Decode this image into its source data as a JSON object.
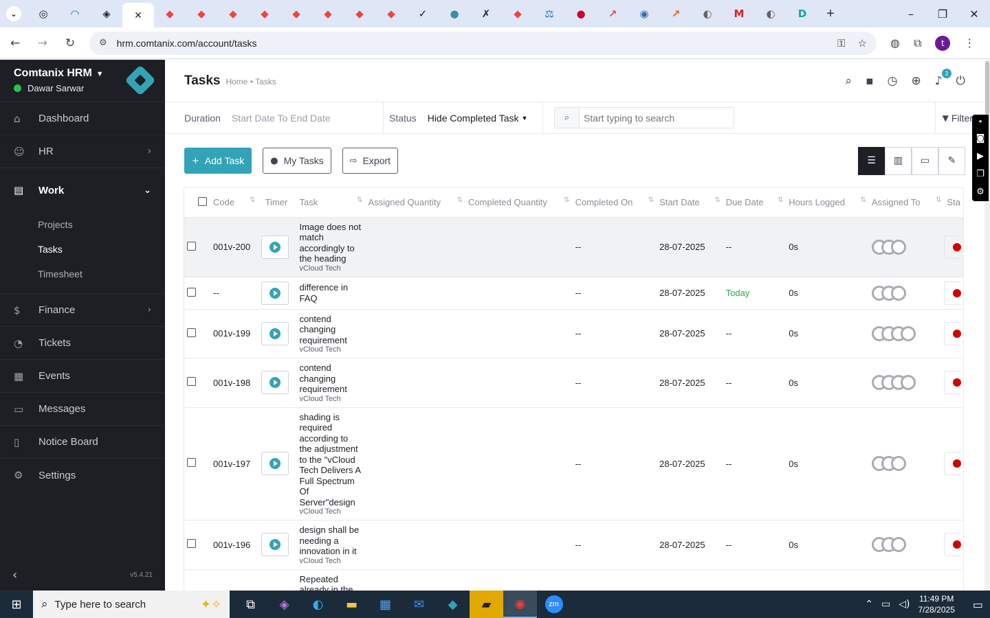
{
  "browser": {
    "tabs": [
      "◎",
      "◠",
      "◈",
      "✕",
      "◆",
      "◆",
      "◆",
      "◆",
      "◆",
      "◆",
      "◆",
      "◆",
      "✓",
      "●",
      "✗",
      "◆",
      "⚖",
      "●",
      "↗",
      "◉",
      "↗",
      "◐",
      "M",
      "◐",
      "D"
    ],
    "new_tab": "+",
    "url": "hrm.comtanix.com/account/tasks"
  },
  "sidebar": {
    "company": "Comtanix HRM",
    "user": "Dawar Sarwar",
    "items": [
      {
        "label": "Dashboard",
        "icon": "⌂"
      },
      {
        "label": "HR",
        "icon": "☺"
      },
      {
        "label": "Work",
        "icon": "▤"
      },
      {
        "label": "Finance",
        "icon": "$"
      },
      {
        "label": "Tickets",
        "icon": "◔"
      },
      {
        "label": "Events",
        "icon": "▦"
      },
      {
        "label": "Messages",
        "icon": "▭"
      },
      {
        "label": "Notice Board",
        "icon": "▯"
      },
      {
        "label": "Settings",
        "icon": "⚙"
      }
    ],
    "work_sub": [
      "Projects",
      "Tasks",
      "Timesheet"
    ],
    "version": "v5.4.21"
  },
  "header": {
    "title": "Tasks",
    "breadcrumb": "Home • Tasks",
    "notif_count": "2"
  },
  "filters": {
    "duration_label": "Duration",
    "duration_value": "Start Date To End Date",
    "status_label": "Status",
    "status_value": "Hide Completed Task",
    "search_placeholder": "Start typing to search",
    "filters_label": "Filters"
  },
  "actions": {
    "add_task": "Add Task",
    "my_tasks": "My Tasks",
    "export": "Export"
  },
  "table": {
    "columns": [
      "Code",
      "Timer",
      "Task",
      "Assigned Quantity",
      "Completed Quantity",
      "Completed On",
      "Start Date",
      "Due Date",
      "Hours Logged",
      "Assigned To",
      "Sta"
    ],
    "rows": [
      {
        "code": "001v-200",
        "task": "Image does not match accordingly to the heading",
        "project": "vCloud Tech",
        "completed_on": "--",
        "start": "28-07-2025",
        "due": "--",
        "hours": "0s",
        "avatars": 3,
        "today": false
      },
      {
        "code": "--",
        "task": "difference in FAQ",
        "project": "",
        "completed_on": "--",
        "start": "28-07-2025",
        "due": "Today",
        "hours": "0s",
        "avatars": 3,
        "today": true
      },
      {
        "code": "001v-199",
        "task": "contend changing requirement",
        "project": "vCloud Tech",
        "completed_on": "--",
        "start": "28-07-2025",
        "due": "--",
        "hours": "0s",
        "avatars": 4,
        "today": false
      },
      {
        "code": "001v-198",
        "task": "contend changing requirement",
        "project": "vCloud Tech",
        "completed_on": "--",
        "start": "28-07-2025",
        "due": "--",
        "hours": "0s",
        "avatars": 4,
        "today": false
      },
      {
        "code": "001v-197",
        "task": "shading is required according to the adjustment to the \"vCloud Tech Delivers A Full Spectrum Of Server\"design",
        "project": "vCloud Tech",
        "completed_on": "--",
        "start": "28-07-2025",
        "due": "--",
        "hours": "0s",
        "avatars": 3,
        "today": false
      },
      {
        "code": "001v-196",
        "task": "design shall be needing a innovation in it",
        "project": "vCloud Tech",
        "completed_on": "--",
        "start": "28-07-2025",
        "due": "--",
        "hours": "0s",
        "avatars": 3,
        "today": false
      },
      {
        "code": "",
        "task": "Repeated already in the",
        "project": "",
        "completed_on": "",
        "start": "",
        "due": "",
        "hours": "",
        "avatars": 0,
        "today": false
      }
    ]
  },
  "taskbar": {
    "search_placeholder": "Type here to search",
    "time": "11:49 PM",
    "date": "7/28/2025"
  },
  "colors": {
    "accent": "#33a3b7",
    "sidebar_bg": "#1d1f25",
    "status_red": "#d30000",
    "today_green": "#27a74a"
  }
}
